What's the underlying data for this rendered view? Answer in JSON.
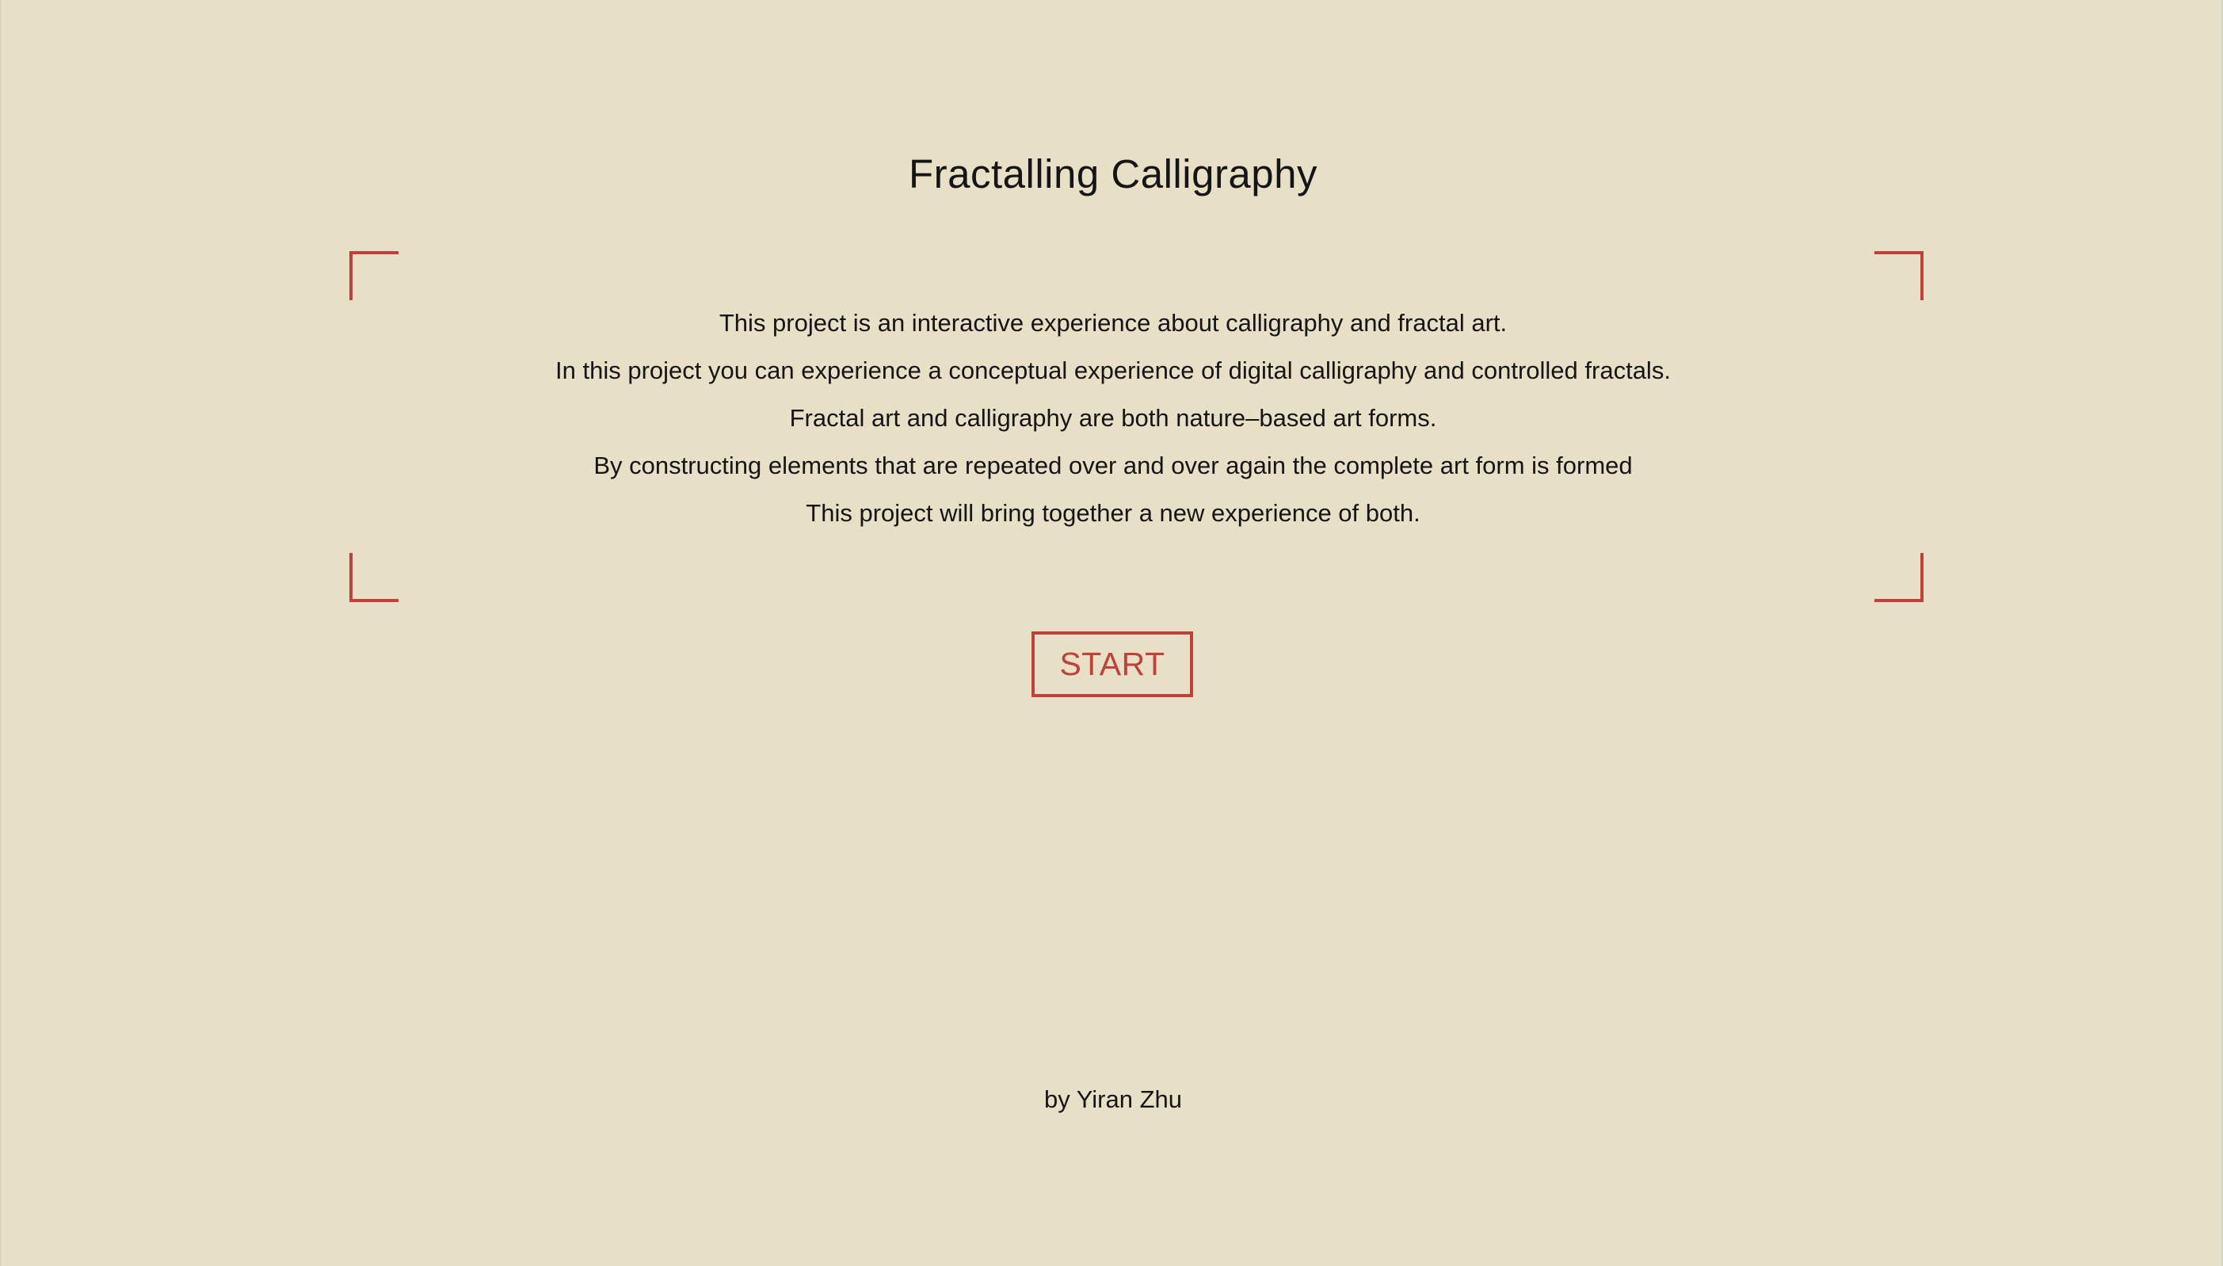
{
  "page": {
    "title": "Fractalling Calligraphy",
    "intro_lines": [
      "This project is an interactive experience about calligraphy and fractal art.",
      "In this project you can experience a conceptual experience of digital calligraphy and controlled fractals.",
      "Fractal art and calligraphy are both nature–based art forms.",
      "By constructing elements that are repeated over and over again the complete art form is formed",
      "This project will bring together a new experience of both."
    ],
    "start_label": "START",
    "author": "by Yiran Zhu"
  },
  "colors": {
    "background": "#e8dfc7",
    "accent": "#c0413c",
    "text": "#151515"
  }
}
